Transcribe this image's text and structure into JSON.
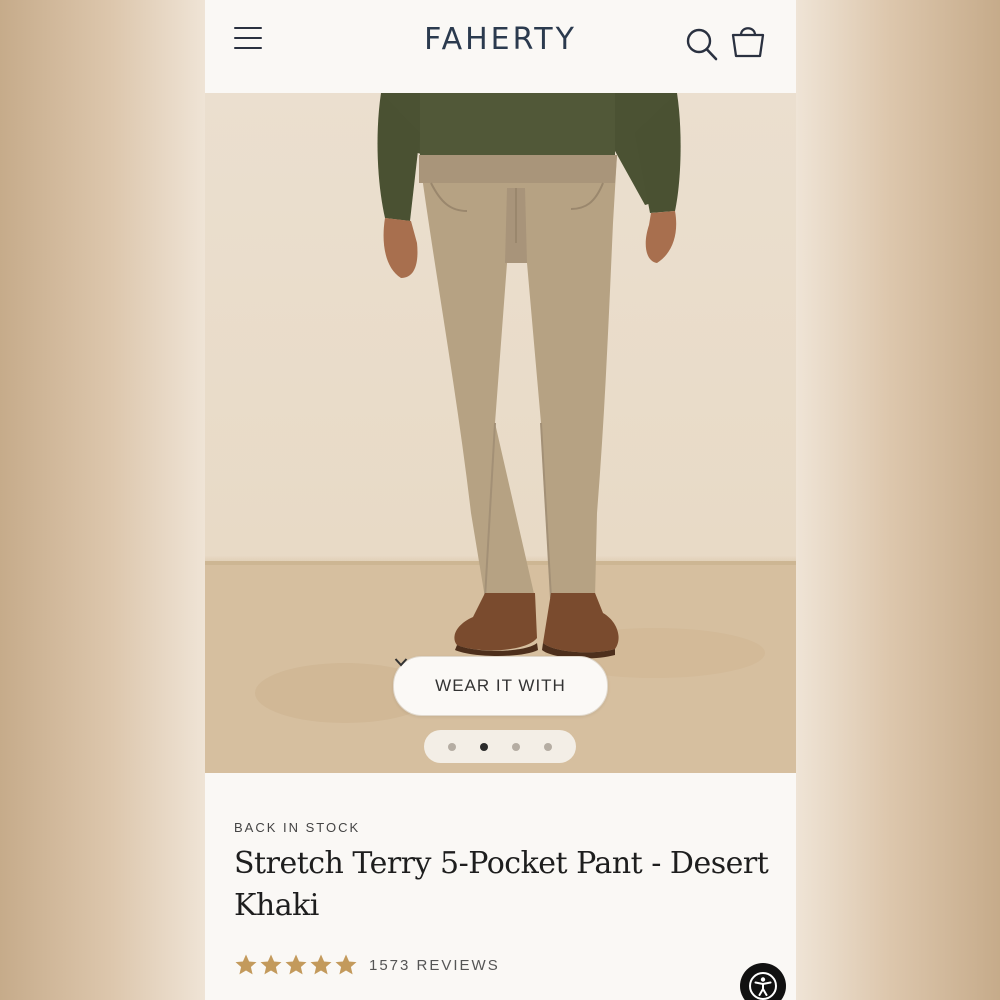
{
  "brand": {
    "logo_text": "FAHERTY"
  },
  "header": {
    "menu_icon": "hamburger-menu-icon",
    "search_icon": "search-icon",
    "bag_icon": "shopping-bag-icon"
  },
  "hero": {
    "wear_it_with_label": "WEAR IT WITH",
    "carousel": {
      "total": 4,
      "active_index": 1
    }
  },
  "product": {
    "stock_status": "BACK IN STOCK",
    "title": "Stretch Terry 5-Pocket Pant - Desert Khaki",
    "rating_stars": 5,
    "reviews_label": "1573 REVIEWS"
  },
  "accessibility_button_icon": "accessibility-icon",
  "colors": {
    "logo": "#2b3a4e",
    "star": "#c39a5c",
    "page_bg": "#faf8f5"
  }
}
